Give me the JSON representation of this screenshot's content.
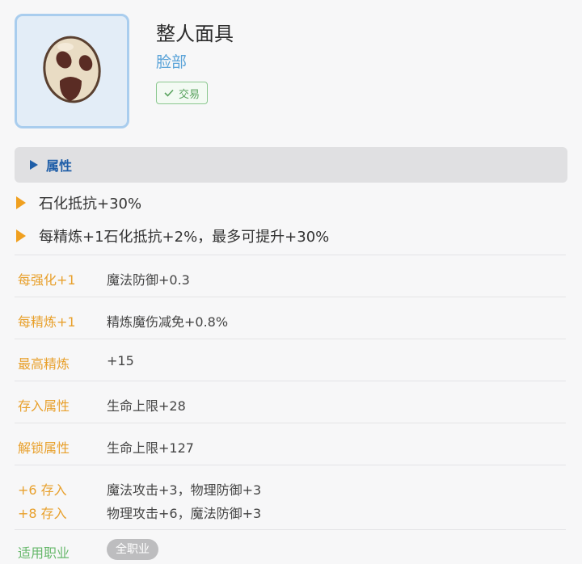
{
  "item": {
    "name": "整人面具",
    "slot": "脸部",
    "trade_label": "交易",
    "icon": "prank-mask-icon",
    "trade_icon": "check-icon"
  },
  "section": {
    "label": "属性",
    "icon": "triangle-right-icon"
  },
  "attributes": [
    "石化抵抗+30%",
    "每精炼+1石化抵抗+2%，最多可提升+30%"
  ],
  "rows": [
    {
      "label": "每强化+1",
      "value": "魔法防御+0.3"
    },
    {
      "label": "每精炼+1",
      "value": "精炼魔伤减免+0.8%"
    },
    {
      "label": "最高精炼",
      "value": "+15"
    },
    {
      "label": "存入属性",
      "value": "生命上限+28"
    },
    {
      "label": "解锁属性",
      "value": "生命上限+127"
    }
  ],
  "deposit_rows": [
    {
      "label": "+6 存入",
      "value": "魔法攻击+3，物理防御+3"
    },
    {
      "label": "+8 存入",
      "value": "物理攻击+6，魔法防御+3"
    }
  ],
  "job": {
    "label": "适用职业",
    "value": "全职业"
  },
  "colors": {
    "accent_blue": "#1f5ea8",
    "label_orange": "#e8a02c",
    "job_green": "#67b86b",
    "trade_green": "#5aa35f"
  }
}
